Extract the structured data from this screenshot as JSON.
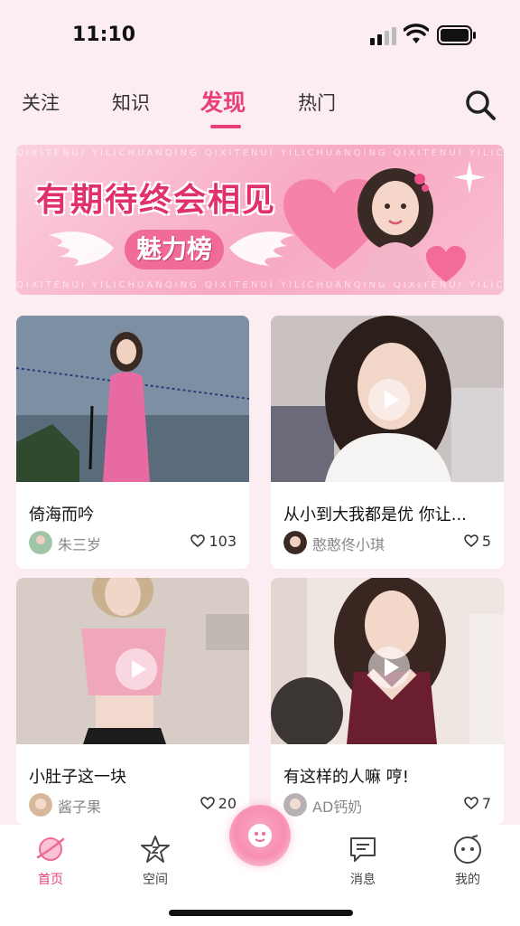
{
  "status": {
    "time": "11:10"
  },
  "tabs": [
    {
      "label": "关注"
    },
    {
      "label": "知识"
    },
    {
      "label": "发现",
      "active": true
    },
    {
      "label": "热门"
    }
  ],
  "banner": {
    "ribbon_text": "QIXITENUI YILICHUANQING QIXITENUI YILICHUANQING QIXITENUI YILICHUANQING",
    "title": "有期待终会相见",
    "subtitle": "魅力榜"
  },
  "cards": [
    {
      "title": "倚海而吟",
      "author": "朱三岁",
      "likes": "103",
      "is_video": false
    },
    {
      "title": "从小到大我都是优 你让...",
      "author": "憨憨佟小琪",
      "likes": "5",
      "is_video": true
    },
    {
      "title": "小肚子这一块",
      "author": "酱子果",
      "likes": "20",
      "is_video": true
    },
    {
      "title": "有这样的人嘛 哼!",
      "author": "AD钙奶",
      "likes": "7",
      "is_video": true
    }
  ],
  "nav": [
    {
      "label": "首页",
      "icon": "home-planet-icon",
      "active": true
    },
    {
      "label": "空间",
      "icon": "star-icon"
    },
    {
      "label": "消息",
      "icon": "message-icon"
    },
    {
      "label": "我的",
      "icon": "face-icon"
    }
  ],
  "colors": {
    "accent": "#e8407a",
    "background": "#fcedf3"
  }
}
